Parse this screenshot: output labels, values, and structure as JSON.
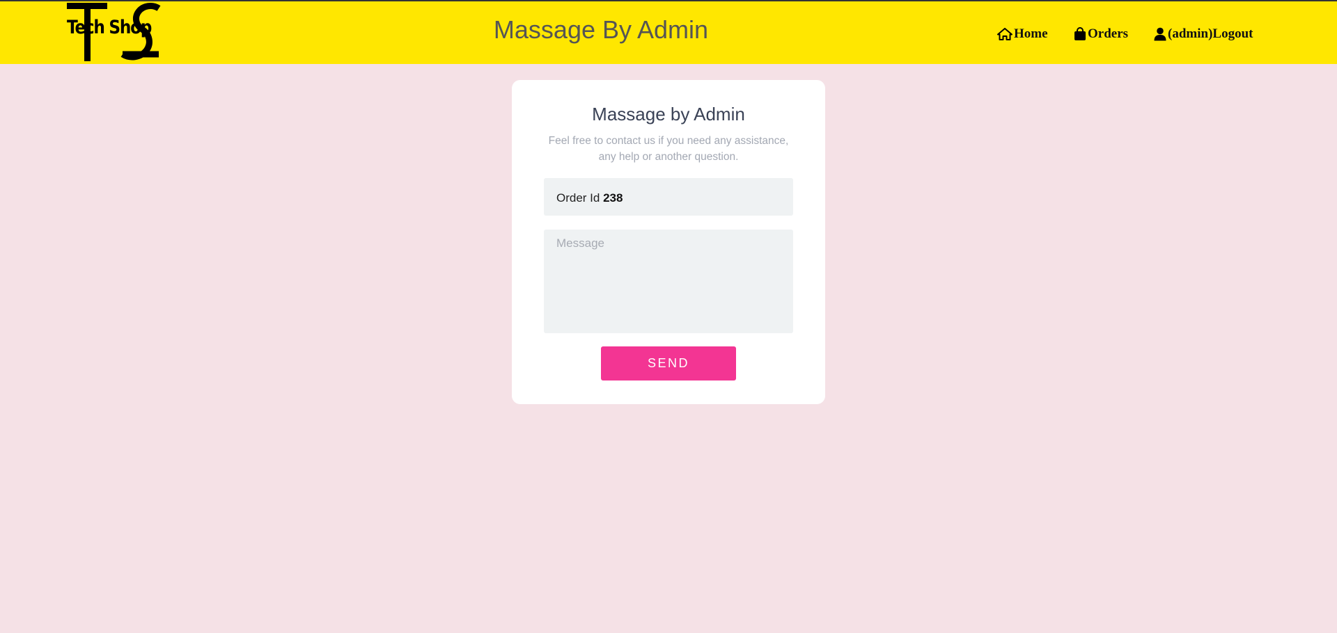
{
  "header": {
    "logo_text": "Tech Shop",
    "title": "Massage By Admin",
    "nav": {
      "home": "Home",
      "orders": "Orders",
      "logout": "(admin)Logout"
    }
  },
  "form": {
    "title": "Massage by Admin",
    "subtitle": "Feel free to contact us if you need any assistance, any help or another question.",
    "order_label": "Order Id",
    "order_id": "238",
    "message_placeholder": "Message",
    "message_value": "",
    "send_label": "SEND"
  },
  "colors": {
    "header_bg": "#ffe700",
    "page_bg": "#f5e1e6",
    "button_bg": "#f33593"
  }
}
